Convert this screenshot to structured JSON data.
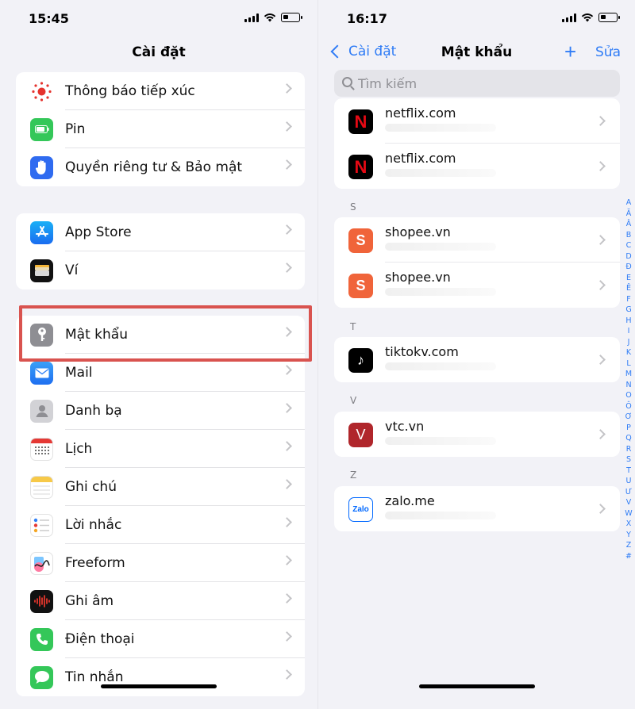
{
  "left": {
    "time": "15:45",
    "title": "Cài đặt",
    "groups": [
      {
        "items": [
          {
            "label": "Thông báo tiếp xúc",
            "icon": "exposure-notification-icon",
            "color": "#ffffff"
          },
          {
            "label": "Pin",
            "icon": "battery-icon",
            "color": "#34c759"
          },
          {
            "label": "Quyền riêng tư & Bảo mật",
            "icon": "privacy-hand-icon",
            "color": "#2f6bf0"
          }
        ]
      },
      {
        "items": [
          {
            "label": "App Store",
            "icon": "app-store-icon",
            "color": "#1d8bf2"
          },
          {
            "label": "Ví",
            "icon": "wallet-icon",
            "color": "#111111"
          }
        ]
      },
      {
        "items": [
          {
            "label": "Mật khẩu",
            "icon": "key-icon",
            "color": "#8e8e93"
          },
          {
            "label": "Mail",
            "icon": "mail-icon",
            "color": "#2f80f6"
          },
          {
            "label": "Danh bạ",
            "icon": "contacts-icon",
            "color": "#c7c7cc"
          },
          {
            "label": "Lịch",
            "icon": "calendar-icon",
            "color": "#ffffff"
          },
          {
            "label": "Ghi chú",
            "icon": "notes-icon",
            "color": "#ffffff"
          },
          {
            "label": "Lời nhắc",
            "icon": "reminders-icon",
            "color": "#ffffff"
          },
          {
            "label": "Freeform",
            "icon": "freeform-icon",
            "color": "#ffffff"
          },
          {
            "label": "Ghi âm",
            "icon": "voice-memos-icon",
            "color": "#111111"
          },
          {
            "label": "Điện thoại",
            "icon": "phone-icon",
            "color": "#34c759"
          },
          {
            "label": "Tin nhắn",
            "icon": "messages-icon",
            "color": "#34c759"
          }
        ]
      }
    ]
  },
  "right": {
    "time": "16:17",
    "back_label": "Cài đặt",
    "title": "Mật khẩu",
    "add_label": "+",
    "edit_label": "Sửa",
    "search_placeholder": "Tìm kiếm",
    "sections": [
      {
        "header": "",
        "items": [
          {
            "site": "netflix.com",
            "icon": "netflix-icon",
            "color": "#000000",
            "glyph": "N",
            "glyph_color": "#e50914"
          },
          {
            "site": "netflix.com",
            "icon": "netflix-icon",
            "color": "#000000",
            "glyph": "N",
            "glyph_color": "#e50914"
          }
        ]
      },
      {
        "header": "S",
        "items": [
          {
            "site": "shopee.vn",
            "icon": "shopee-icon",
            "color": "#f0643a",
            "glyph": "S",
            "glyph_color": "#ffffff"
          },
          {
            "site": "shopee.vn",
            "icon": "shopee-icon",
            "color": "#f0643a",
            "glyph": "S",
            "glyph_color": "#ffffff"
          }
        ]
      },
      {
        "header": "T",
        "items": [
          {
            "site": "tiktokv.com",
            "icon": "tiktok-icon",
            "color": "#000000",
            "glyph": "♪",
            "glyph_color": "#ffffff"
          }
        ]
      },
      {
        "header": "V",
        "items": [
          {
            "site": "vtc.vn",
            "icon": "vtc-icon",
            "color": "#b0262b",
            "glyph": "V",
            "glyph_color": "#ffffff"
          }
        ]
      },
      {
        "header": "Z",
        "items": [
          {
            "site": "zalo.me",
            "icon": "zalo-icon",
            "color": "#ffffff",
            "glyph": "Zalo",
            "glyph_color": "#0068ff"
          }
        ]
      }
    ],
    "index": [
      "A",
      "Ă",
      "Â",
      "B",
      "C",
      "D",
      "Đ",
      "E",
      "Ê",
      "F",
      "G",
      "H",
      "I",
      "J",
      "K",
      "L",
      "M",
      "N",
      "O",
      "Ô",
      "Ơ",
      "P",
      "Q",
      "R",
      "S",
      "T",
      "U",
      "Ư",
      "V",
      "W",
      "X",
      "Y",
      "Z",
      "#"
    ]
  },
  "colors": {
    "accent": "#2f7cf6",
    "highlight": "#d9534f"
  }
}
